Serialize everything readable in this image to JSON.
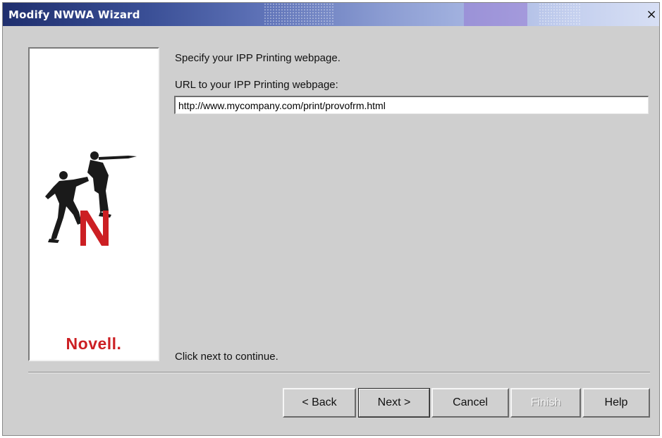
{
  "window": {
    "title": "Modify NWWA Wizard",
    "close_glyph": "×",
    "colors": {
      "title_bar": "#3a4f96",
      "dialog_bg": "#cfcfcf",
      "logo_red": "#cc1f23"
    }
  },
  "sidebar": {
    "logo_text": "Novell.",
    "artwork_icon": "novell-figures-logo-icon"
  },
  "main": {
    "instruction": "Specify your IPP Printing webpage.",
    "url_label": "URL to your IPP Printing webpage:",
    "url_value": "http://www.mycompany.com/print/provofrm.html",
    "footer_text": "Click next to continue."
  },
  "buttons": {
    "back": "< Back",
    "next": "Next >",
    "cancel": "Cancel",
    "finish": "Finish",
    "help": "Help"
  }
}
